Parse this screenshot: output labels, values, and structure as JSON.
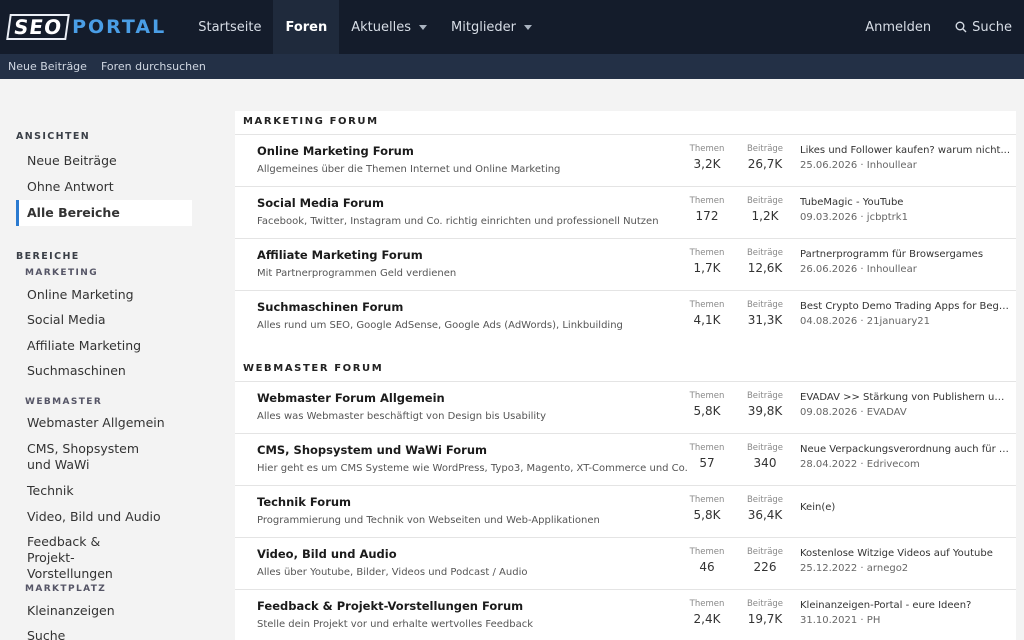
{
  "header": {
    "logo_seo": "SEO",
    "logo_portal": "PORTAL",
    "nav": [
      {
        "label": "Startseite"
      },
      {
        "label": "Foren"
      },
      {
        "label": "Aktuelles"
      },
      {
        "label": "Mitglieder"
      }
    ],
    "login": "Anmelden",
    "search": "Suche"
  },
  "subnav": [
    "Neue Beiträge",
    "Foren durchsuchen"
  ],
  "sidebar": {
    "ansichten_title": "ANSICHTEN",
    "ansichten": [
      "Neue Beiträge",
      "Ohne Antwort",
      "Alle Bereiche"
    ],
    "bereiche_title": "BEREICHE",
    "marketing_title": "MARKETING",
    "marketing": [
      "Online Marketing",
      "Social Media",
      "Affiliate Marketing",
      "Suchmaschinen"
    ],
    "webmaster_title": "WEBMASTER",
    "webmaster": [
      "Webmaster Allgemein",
      "CMS, Shopsystem und WaWi",
      "Technik",
      "Video, Bild und Audio",
      "Feedback & Projekt-Vorstellungen"
    ],
    "marktplatz_title": "MARKTPLATZ",
    "marktplatz": [
      "Kleinanzeigen",
      "Suche"
    ]
  },
  "main": {
    "labels": {
      "themen": "Themen",
      "beitraege": "Beiträge"
    },
    "sections": [
      {
        "title": "MARKETING FORUM",
        "forums": [
          {
            "title": "Online Marketing Forum",
            "desc": "Allgemeines über die Themen Internet und Online Marketing",
            "themen": "3,2K",
            "beitraege": "26,7K",
            "last_title": "Likes und Follower kaufen? warum nicht...",
            "last_meta": "25.06.2026 · Inhoullear"
          },
          {
            "title": "Social Media Forum",
            "desc": "Facebook, Twitter, Instagram und Co. richtig einrichten und professionell Nutzen",
            "themen": "172",
            "beitraege": "1,2K",
            "last_title": "TubeMagic - YouTube",
            "last_meta": "09.03.2026 · jcbptrk1"
          },
          {
            "title": "Affiliate Marketing Forum",
            "desc": "Mit Partnerprogrammen Geld verdienen",
            "themen": "1,7K",
            "beitraege": "12,6K",
            "last_title": "Partnerprogramm für Browsergames",
            "last_meta": "26.06.2026 · Inhoullear"
          },
          {
            "title": "Suchmaschinen Forum",
            "desc": "Alles rund um SEO, Google AdSense, Google Ads (AdWords), Linkbuilding",
            "themen": "4,1K",
            "beitraege": "31,3K",
            "last_title": "Best Crypto Demo Trading Apps for Begin...",
            "last_meta": "04.08.2026 · 21january21"
          }
        ]
      },
      {
        "title": "WEBMASTER FORUM",
        "forums": [
          {
            "title": "Webmaster Forum Allgemein",
            "desc": "Alles was Webmaster beschäftigt von Design bis Usability",
            "themen": "5,8K",
            "beitraege": "39,8K",
            "last_title": "EVADAV >> Stärkung von Publishern und ...",
            "last_meta": "09.08.2026 · EVADAV"
          },
          {
            "title": "CMS, Shopsystem und WaWi Forum",
            "desc": "Hier geht es um CMS Systeme wie WordPress, Typo3, Magento, XT-Commerce und Co.",
            "themen": "57",
            "beitraege": "340",
            "last_title": "Neue Verpackungsverordnung auch für S...",
            "last_meta": "28.04.2022 · Edrivecom"
          },
          {
            "title": "Technik Forum",
            "desc": "Programmierung und Technik von Webseiten und Web-Applikationen",
            "themen": "5,8K",
            "beitraege": "36,4K",
            "last_title": "Kein(e)",
            "last_meta": ""
          },
          {
            "title": "Video, Bild und Audio",
            "desc": "Alles über Youtube, Bilder, Videos und Podcast / Audio",
            "themen": "46",
            "beitraege": "226",
            "last_title": "Kostenlose Witzige Videos auf Youtube",
            "last_meta": "25.12.2022 · arnego2"
          },
          {
            "title": "Feedback & Projekt-Vorstellungen Forum",
            "desc": "Stelle dein Projekt vor und erhalte wertvolles Feedback",
            "themen": "2,4K",
            "beitraege": "19,7K",
            "last_title": "Kleinanzeigen-Portal - eure Ideen?",
            "last_meta": "31.10.2021 · PH"
          }
        ]
      }
    ]
  },
  "colors": {
    "topbar": "#141c2b",
    "subbar": "#233046",
    "accent": "#2a7ad0",
    "logo_blue": "#4a9ee6"
  }
}
